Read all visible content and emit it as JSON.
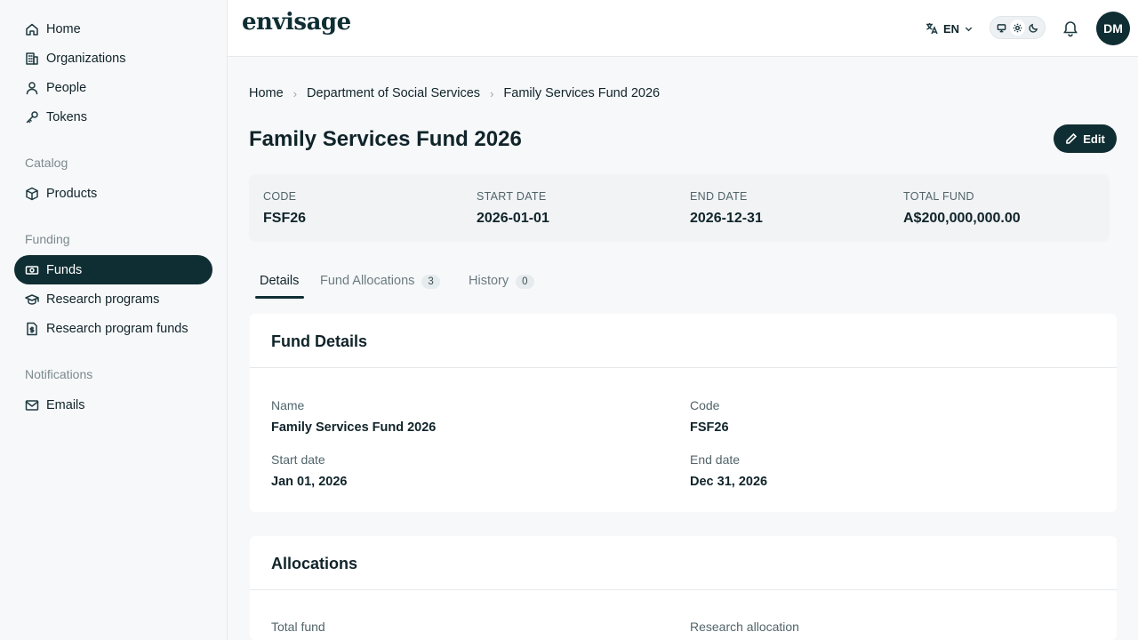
{
  "sidebar": {
    "items": [
      {
        "label": "Home",
        "icon": "home-icon"
      },
      {
        "label": "Organizations",
        "icon": "building-icon"
      },
      {
        "label": "People",
        "icon": "person-icon"
      },
      {
        "label": "Tokens",
        "icon": "key-icon"
      }
    ],
    "catalog_label": "Catalog",
    "catalog_items": [
      {
        "label": "Products",
        "icon": "box-icon"
      }
    ],
    "funding_label": "Funding",
    "funding_items": [
      {
        "label": "Funds",
        "icon": "banknote-icon",
        "active": true
      },
      {
        "label": "Research programs",
        "icon": "graduation-cap-icon"
      },
      {
        "label": "Research program funds",
        "icon": "dollar-file-icon"
      }
    ],
    "notifications_label": "Notifications",
    "notifications_items": [
      {
        "label": "Emails",
        "icon": "mail-icon"
      }
    ]
  },
  "header": {
    "logo": "envisage",
    "language": "EN",
    "avatar_initials": "DM",
    "accent_color": "#0f2e33"
  },
  "breadcrumb": [
    "Home",
    "Department of Social Services",
    "Family Services Fund 2026"
  ],
  "page": {
    "title": "Family Services Fund 2026",
    "edit_label": "Edit"
  },
  "summary": {
    "code_label": "CODE",
    "code": "FSF26",
    "start_label": "START DATE",
    "start": "2026-01-01",
    "end_label": "END DATE",
    "end": "2026-12-31",
    "total_label": "TOTAL FUND",
    "total": "A$200,000,000.00"
  },
  "tabs": [
    {
      "label": "Details",
      "count": null,
      "active": true
    },
    {
      "label": "Fund Allocations",
      "count": "3"
    },
    {
      "label": "History",
      "count": "0"
    }
  ],
  "fund_details": {
    "title": "Fund Details",
    "name_label": "Name",
    "name": "Family Services Fund 2026",
    "code_label": "Code",
    "code": "FSF26",
    "start_label": "Start date",
    "start": "Jan 01, 2026",
    "end_label": "End date",
    "end": "Dec 31, 2026"
  },
  "allocations": {
    "title": "Allocations",
    "total_label": "Total fund",
    "research_label": "Research allocation"
  }
}
